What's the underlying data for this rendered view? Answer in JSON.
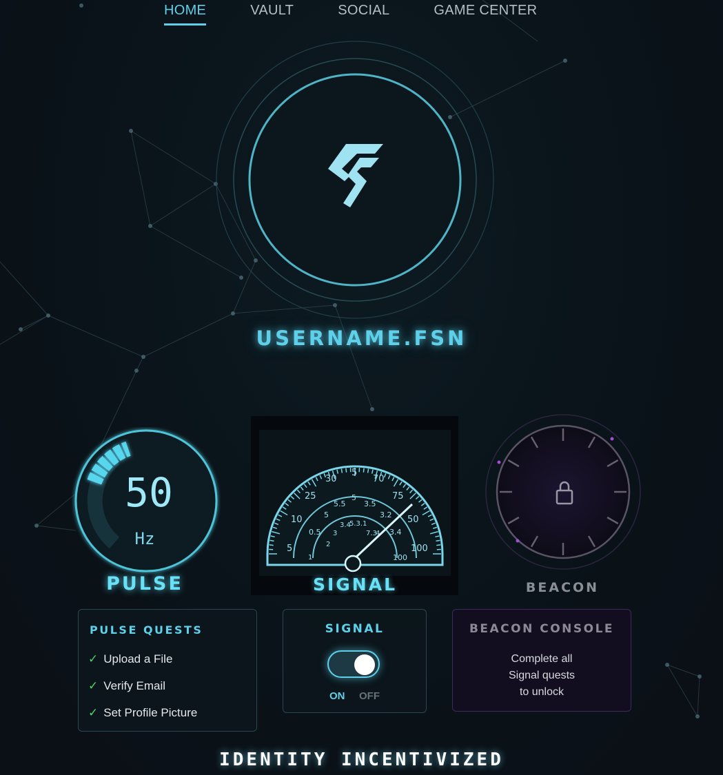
{
  "nav": {
    "items": [
      {
        "label": "HOME",
        "active": true
      },
      {
        "label": "VAULT",
        "active": false
      },
      {
        "label": "SOCIAL",
        "active": false
      },
      {
        "label": "GAME CENTER",
        "active": false
      }
    ]
  },
  "profile": {
    "username": "USERNAME.FSN",
    "logo_icon": "fusion-s-logo-icon"
  },
  "pulse": {
    "value": "50",
    "unit": "Hz",
    "label": "PULSE",
    "level_fraction": 0.3
  },
  "signal": {
    "label": "SIGNAL",
    "outer_scale": [
      "5",
      "10",
      "25",
      "30",
      "5",
      "70",
      "75",
      "50",
      "100"
    ],
    "middle_scale": [
      "0.5",
      "5",
      "5.5",
      "5",
      "3.5",
      "3.2",
      "3.4",
      "100"
    ],
    "inner_scale": [
      "1",
      "2",
      "3",
      "3.4",
      "5.3.1",
      "7.3",
      "4",
      "100"
    ],
    "needle": "gauge-needle"
  },
  "beacon": {
    "label": "BEACON",
    "locked": true,
    "lock_icon": "lock-icon"
  },
  "quests": {
    "title": "PULSE QUESTS",
    "items": [
      {
        "label": "Upload a File",
        "done": true
      },
      {
        "label": "Verify Email",
        "done": true
      },
      {
        "label": "Set Profile Picture",
        "done": true
      }
    ],
    "check_glyph": "✓"
  },
  "signal_panel": {
    "title": "SIGNAL",
    "on_label": "ON",
    "off_label": "OFF",
    "state": "on"
  },
  "beacon_console": {
    "title": "BEACON CONSOLE",
    "line1": "Complete all",
    "line2": "Signal quests",
    "line3": "to unlock"
  },
  "tagline": "IDENTITY INCENTIVIZED",
  "colors": {
    "accent": "#5fd0ea",
    "check": "#4cd26a",
    "beacon_purple": "#a64bd8",
    "background": "#0a141a"
  }
}
